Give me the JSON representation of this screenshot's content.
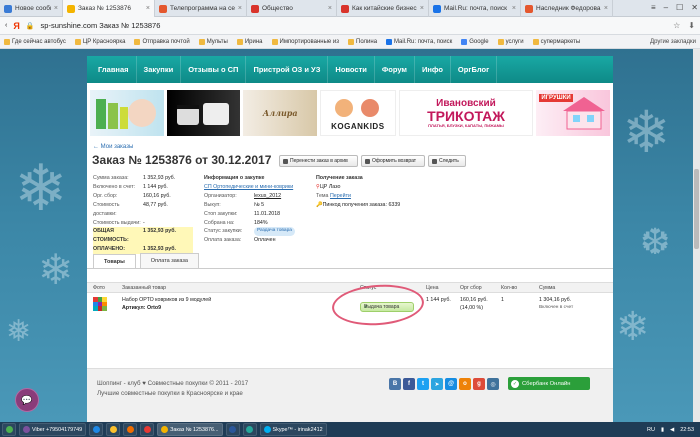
{
  "browser": {
    "tabs": [
      {
        "label": "Новое сообщение",
        "color": "#3a7bd5"
      },
      {
        "label": "Заказ № 1253876",
        "color": "#f4b400",
        "active": true
      },
      {
        "label": "Телепрограмма на сего",
        "color": "#e4572e"
      },
      {
        "label": "Общество",
        "color": "#d9342b"
      },
      {
        "label": "Как китайские бизнесм",
        "color": "#d9342b"
      },
      {
        "label": "Mail.Ru: почта, поиск",
        "color": "#1a73e8"
      },
      {
        "label": "Наследник Федорова",
        "color": "#e4572e"
      }
    ],
    "window_controls": [
      "≡",
      "–",
      "☐",
      "✕"
    ],
    "yandex": "Я",
    "url": "sp-sunshine.com   Заказ № 1253876",
    "addr_icons": [
      "☆",
      "⬇"
    ],
    "bookmarks": [
      "Где сейчас автобус",
      "ЦР Красноярка",
      "Отправка почтой",
      "Мульты",
      "Ирина",
      "Импортированные из",
      "Полина",
      "Mail.Ru: почта, поиск",
      "Google",
      "услуги",
      "супермаркеты"
    ],
    "bookmarks_other": "Другие закладки"
  },
  "site": {
    "nav": [
      "Главная",
      "Закупки",
      "Отзывы о СП",
      "Пристрой ОЗ и УЗ",
      "Новости",
      "Форум",
      "Инфо",
      "ОргБлог"
    ],
    "banners": {
      "b3_text": "Аллира",
      "b4_text": "KOGANKIDS",
      "b5_line1": "Ивановский",
      "b5_line2": "ТРИКОТАЖ",
      "b5_line3": "ПЛАТЬЯ, БЛУЗКИ, КАПАТЫ, ПИЖАМЫ",
      "b6_text": "ИГРУШКИ"
    },
    "breadcrumb": "← Мои заказы",
    "title": "Заказ № 1253876 от 30.12.2017",
    "action_buttons": [
      "Перенести заказ в архив",
      "Оформить возврат",
      "Следить"
    ],
    "summary": [
      {
        "k": "Сумма заказа:",
        "v": "1 352,93 руб."
      },
      {
        "k": "Включено в счет:",
        "v": "1 144 руб."
      },
      {
        "k": "Орг. сбор:",
        "v": "160,16 руб."
      },
      {
        "k": "Стоимость доставки:",
        "v": "48,77 руб."
      },
      {
        "k": "Стоимость выдачи:",
        "v": "-"
      }
    ],
    "total": {
      "k": "ОБЩАЯ СТОИМОСТЬ:",
      "v": "1 352,93 руб."
    },
    "paid": {
      "k": "ОПЛАЧЕНО:",
      "v": "1 352,93 руб."
    },
    "purchase_info": {
      "header": "Информация о закупке",
      "link": "СП Ортопедические и мини-коврики",
      "rows": [
        {
          "k": "Организатор:",
          "v": "lexus_2012"
        },
        {
          "k": "Выкуп:",
          "v": "№ 5"
        },
        {
          "k": "Стоп закупки:",
          "v": "11.01.2018"
        },
        {
          "k": "Собрана на:",
          "v": "184%"
        },
        {
          "k": "Статус закупки:",
          "v": "Раздача товара"
        },
        {
          "k": "Оплата заказа:",
          "v": "Оплачен"
        }
      ]
    },
    "pickup": {
      "header": "Получение заказа",
      "place": "ЦР Лазо",
      "theme_k": "Тема",
      "theme_v": "Перейти",
      "pin": "Пинкод получения заказа: 6339"
    },
    "tabs": [
      "Товары",
      "Оплата заказа"
    ],
    "table_header": [
      "Фото",
      "Заказанный товар",
      "Статус",
      "Цена",
      "Орг сбор",
      "Кол-во",
      "Сумма"
    ],
    "item": {
      "name": "Набор ОРТО ковриков из 9 модулей",
      "article": "Артикул: Orto9",
      "status": "Выдача товара",
      "price": "1 144 руб.",
      "fee": "160,16 руб.",
      "fee_pct": "(14,00 %)",
      "qty": "1",
      "sum": "1 304,16 руб.",
      "sum_note": "Включен в счет"
    },
    "footer": {
      "line1": "Шоппинг - клуб ♥ Совместные покупки © 2011 - 2017",
      "line2": "Лучшие совместные покупки в Красноярске и крае",
      "sber": "Сбербанк Онлайн"
    }
  },
  "taskbar": {
    "items": [
      "Viber +79504179749",
      "Заказ № 1253876...",
      "Skype™ - irinak2412"
    ],
    "lang": "RU",
    "time": "22:53"
  }
}
